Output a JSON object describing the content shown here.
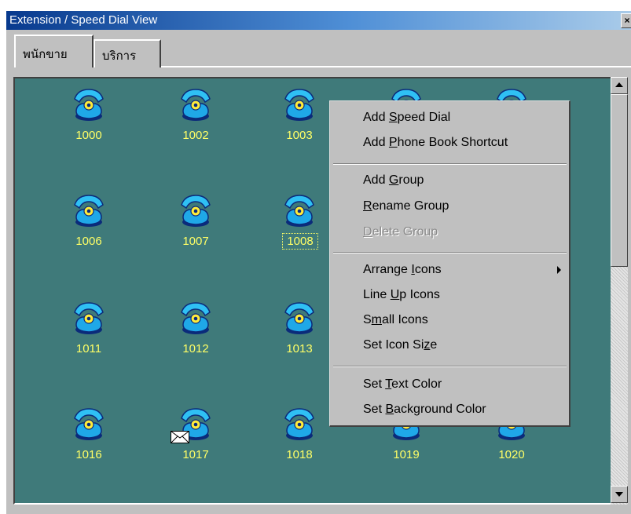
{
  "window": {
    "title": "Extension / Speed Dial View",
    "close_glyph": "×"
  },
  "tabs": [
    {
      "label": "พนักขาย"
    },
    {
      "label": "บริการ"
    }
  ],
  "icons": [
    {
      "label": "1000"
    },
    {
      "label": "1002"
    },
    {
      "label": "1003"
    },
    {
      "label": "1006"
    },
    {
      "label": "1007"
    },
    {
      "label": "1008"
    },
    {
      "label": "1011"
    },
    {
      "label": "1012"
    },
    {
      "label": "1013"
    },
    {
      "label": "1016"
    },
    {
      "label": "1017"
    },
    {
      "label": "1018"
    },
    {
      "label": "1019"
    },
    {
      "label": "1020"
    }
  ],
  "context_menu": {
    "items": [
      {
        "pre": "Add ",
        "acc": "S",
        "post": "peed Dial",
        "enabled": true
      },
      {
        "pre": "Add ",
        "acc": "P",
        "post": "hone Book Shortcut",
        "enabled": true
      },
      {
        "pre": "Add ",
        "acc": "G",
        "post": "roup",
        "enabled": true
      },
      {
        "pre": "",
        "acc": "R",
        "post": "ename Group",
        "enabled": true
      },
      {
        "pre": "",
        "acc": "D",
        "post": "elete Group",
        "enabled": false
      },
      {
        "pre": "Arrange ",
        "acc": "I",
        "post": "cons",
        "enabled": true,
        "submenu": true
      },
      {
        "pre": "Line ",
        "acc": "U",
        "post": "p Icons",
        "enabled": true
      },
      {
        "pre": "S",
        "acc": "m",
        "post": "all Icons",
        "enabled": true
      },
      {
        "pre": "Set Icon Si",
        "acc": "z",
        "post": "e",
        "enabled": true
      },
      {
        "pre": "Set ",
        "acc": "T",
        "post": "ext Color",
        "enabled": true
      },
      {
        "pre": "Set ",
        "acc": "B",
        "post": "ackground Color",
        "enabled": true
      }
    ]
  },
  "colors": {
    "view_background": "#3f7a7a",
    "label_text": "#ffff66",
    "phone": "#29b6f6"
  }
}
